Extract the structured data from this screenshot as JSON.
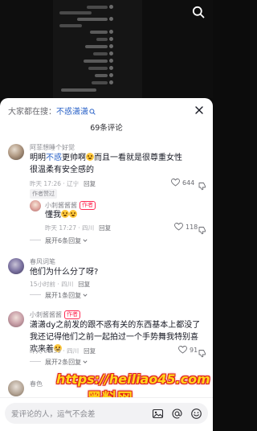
{
  "colors": {
    "accent_link": "#2b63c8",
    "author_badge": "#fe2c55",
    "sheet_bg": "#ffffff"
  },
  "video": {
    "search_icon": "search-icon"
  },
  "header": {
    "suggest_prefix": "大家都在搜：",
    "suggest_keyword": "不惑潇潇",
    "comment_count": "69条评论",
    "close_icon": "close-icon"
  },
  "comments": [
    {
      "username": "阿菲想睡个好觉",
      "text_a": "明明",
      "text_kw": "不惑",
      "text_b": "更帅啊",
      "text_c": "而且一看就是很尊重女性很温柔有安全感的",
      "time": "昨天 17:26 · 辽宁",
      "reply": "回复",
      "tag": "作者赞过",
      "likes": "644"
    },
    {
      "username": "小刺酱酱酱",
      "badge": "作者",
      "text": "懂我",
      "time": "昨天 17:27 · 四川",
      "reply": "回复",
      "likes": "118"
    },
    {
      "expand": "展开6条回复"
    },
    {
      "username": "春风词笔",
      "text": "他们为什么分了呀?",
      "time": "15小时前 · 四川",
      "reply": "回复",
      "expand": "展开1条回复"
    },
    {
      "username": "小刺酱酱酱",
      "badge": "作者",
      "text": "潇潇dy之前发的跟不惑有关的东西基本上都没了 我还记得他们之前一起拍过一个手势舞我特别喜欢来着",
      "time": "昨天 01:39 · 四川",
      "reply": "回复",
      "likes": "91",
      "expand": "展开2条回复"
    },
    {
      "username": "春色"
    }
  ],
  "watermark": {
    "line1": "https://heiliao45.com",
    "line2": "黑料网"
  },
  "input": {
    "placeholder": "爱评论的人，运气不会差",
    "icons": [
      "image-icon",
      "at-icon",
      "emoji-icon"
    ]
  }
}
